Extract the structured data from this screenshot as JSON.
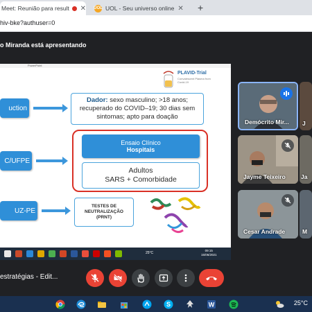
{
  "browser": {
    "tabs": [
      {
        "title": "Meet: Reunião para resultad",
        "active": true
      },
      {
        "title": "UOL - Seu universo online",
        "active": false
      }
    ],
    "url": "hiv-bke?authuser=0"
  },
  "meet": {
    "presenting_banner": "o Miranda está apresentando",
    "meeting_title": "estratégias - Edit...",
    "participants": [
      {
        "name": "Demócrito Mir...",
        "status": "speaking"
      },
      {
        "name": "Jayme Teixeiro",
        "status": "muted"
      },
      {
        "name": "Cesar Andrade",
        "status": "muted"
      }
    ],
    "edge_tiles": [
      "J",
      "Ja",
      "M"
    ],
    "controls": [
      "mic-off",
      "camera-off",
      "raise-hand",
      "present",
      "more",
      "end-call"
    ]
  },
  "slide": {
    "app_label": "PowerPoint",
    "logo_title": "PLAVID-Trial",
    "logo_sub": "Convalescent Plasma from Covid-19",
    "left_boxes": [
      "uction",
      "C/UFPE",
      "UZ-PE"
    ],
    "dador_label": "Dador:",
    "dador_text": " sexo masculino; >18 anos; recuperado do COVID–19; 30 dias sem sintomas; apto para doação",
    "ensaio_title": "Ensaio Clínico",
    "ensaio_sub": "Hospitais",
    "adultos_line1": "Adultos",
    "adultos_line2": "SARS + Comorbidade",
    "testes_line1": "TESTES DE",
    "testes_line2": "NEUTRALIZAÇÃO",
    "testes_line3": "(PRNT)"
  },
  "inner_taskbar": {
    "temp": "25°C",
    "time": "09:15",
    "date": "15/06/2021"
  },
  "taskbar": {
    "temp": "25°C"
  },
  "colors": {
    "meet_bg": "#202124",
    "slide_blue": "#2f8fd8",
    "highlight_red": "#d93025",
    "end_call": "#ea4335"
  }
}
